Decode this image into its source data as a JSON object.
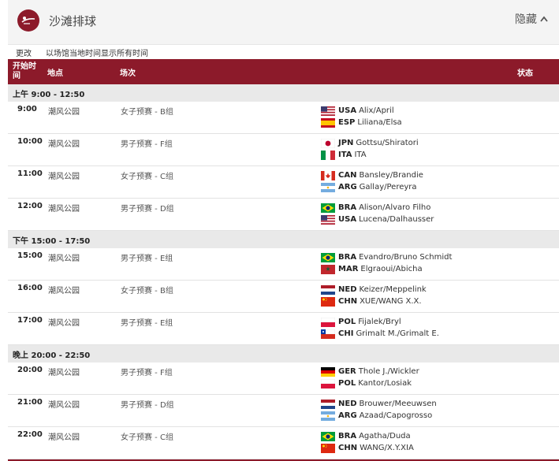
{
  "header": {
    "title": "沙滩排球",
    "collapse_label": "隐藏"
  },
  "toolbar": {
    "change_label": "更改",
    "timezone_text": "以场馆当地时间显示所有时间"
  },
  "columns": {
    "time": "开始时间",
    "venue": "地点",
    "event": "场次",
    "teams": "",
    "status": "状态"
  },
  "periods": [
    {
      "label": "上午  9:00 - 12:50",
      "matches": [
        {
          "time": "9:00",
          "venue": "潮风公园",
          "event": "女子预赛 - B组",
          "teams": [
            {
              "flag": "usa",
              "code": "USA",
              "players": "Alix/April"
            },
            {
              "flag": "esp",
              "code": "ESP",
              "players": "Liliana/Elsa"
            }
          ]
        },
        {
          "time": "10:00",
          "venue": "潮风公园",
          "event": "男子预赛 - F组",
          "teams": [
            {
              "flag": "jpn",
              "code": "JPN",
              "players": "Gottsu/Shiratori"
            },
            {
              "flag": "ita",
              "code": "ITA",
              "players": "ITA"
            }
          ]
        },
        {
          "time": "11:00",
          "venue": "潮风公园",
          "event": "女子预赛 - C组",
          "teams": [
            {
              "flag": "can",
              "code": "CAN",
              "players": "Bansley/Brandie"
            },
            {
              "flag": "arg",
              "code": "ARG",
              "players": "Gallay/Pereyra"
            }
          ]
        },
        {
          "time": "12:00",
          "venue": "潮风公园",
          "event": "男子预赛 - D组",
          "teams": [
            {
              "flag": "bra",
              "code": "BRA",
              "players": "Alison/Alvaro Filho"
            },
            {
              "flag": "usa",
              "code": "USA",
              "players": "Lucena/Dalhausser"
            }
          ]
        }
      ]
    },
    {
      "label": "下午  15:00 - 17:50",
      "matches": [
        {
          "time": "15:00",
          "venue": "潮风公园",
          "event": "男子预赛 - E组",
          "teams": [
            {
              "flag": "bra",
              "code": "BRA",
              "players": "Evandro/Bruno Schmidt"
            },
            {
              "flag": "mar",
              "code": "MAR",
              "players": "Elgraoui/Abicha"
            }
          ]
        },
        {
          "time": "16:00",
          "venue": "潮风公园",
          "event": "女子预赛 - B组",
          "teams": [
            {
              "flag": "ned",
              "code": "NED",
              "players": "Keizer/Meppelink"
            },
            {
              "flag": "chn",
              "code": "CHN",
              "players": "XUE/WANG X.X."
            }
          ]
        },
        {
          "time": "17:00",
          "venue": "潮风公园",
          "event": "男子预赛 - E组",
          "teams": [
            {
              "flag": "pol",
              "code": "POL",
              "players": "Fijalek/Bryl"
            },
            {
              "flag": "chi",
              "code": "CHI",
              "players": "Grimalt M./Grimalt E."
            }
          ]
        }
      ]
    },
    {
      "label": "晚上  20:00 - 22:50",
      "matches": [
        {
          "time": "20:00",
          "venue": "潮风公园",
          "event": "男子预赛 - F组",
          "teams": [
            {
              "flag": "ger",
              "code": "GER",
              "players": "Thole J./Wickler"
            },
            {
              "flag": "pol",
              "code": "POL",
              "players": "Kantor/Losiak"
            }
          ]
        },
        {
          "time": "21:00",
          "venue": "潮风公园",
          "event": "男子预赛 - D组",
          "teams": [
            {
              "flag": "ned",
              "code": "NED",
              "players": "Brouwer/Meeuwsen"
            },
            {
              "flag": "arg",
              "code": "ARG",
              "players": "Azaad/Capogrosso"
            }
          ]
        },
        {
          "time": "22:00",
          "venue": "潮风公园",
          "event": "女子预赛 - C组",
          "teams": [
            {
              "flag": "bra",
              "code": "BRA",
              "players": "Agatha/Duda"
            },
            {
              "flag": "chn",
              "code": "CHN",
              "players": "WANG/X.Y.XIA"
            }
          ]
        }
      ]
    }
  ],
  "colors": {
    "accent": "#8c1a2a",
    "period_bg": "#e9e9e9",
    "header_bg": "#f4f4f4"
  }
}
